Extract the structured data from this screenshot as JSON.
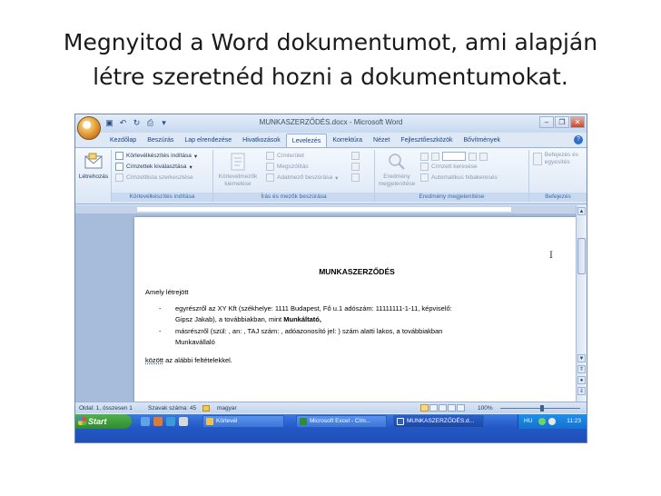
{
  "slide": {
    "title_line1": "Megnyitod a Word dokumentumot, ami alapján",
    "title_line2": "létre szeretnéd hozni a dokumentumokat."
  },
  "window": {
    "title": "MUNKASZERZŐDÉS.docx - Microsoft Word",
    "controls": [
      "–",
      "❐",
      "✕"
    ]
  },
  "ribbon": {
    "tabs": [
      "Kezdőlap",
      "Beszúrás",
      "Lap elrendezése",
      "Hivatkozások",
      "Levelezés",
      "Korrektúra",
      "Nézet",
      "Fejlesztőeszközök",
      "Bővítmények"
    ],
    "active_tab": "Levelezés",
    "groups": {
      "create": {
        "button": "Létrehozás"
      },
      "start_merge": {
        "label": "Körlevélkészítés indítása",
        "items": [
          "Körlevélkészítés indítása",
          "Címzettek kiválasztása",
          "Címzettlista szerkesztése"
        ]
      },
      "write_insert": {
        "label": "Írás és mezők beszúrása",
        "big": "Körlevélmezők kiemelése",
        "items": [
          "Címterület",
          "Megszólítás",
          "Adatmező beszúrása"
        ]
      },
      "preview": {
        "label": "Eredmény megjelenítése",
        "big": "Eredmény megjelenítése",
        "items": [
          "Címzett keresése",
          "Automatikus hibakeresés"
        ]
      },
      "finish": {
        "label": "Befejezés",
        "big": "Befejezés és egyesítés"
      }
    }
  },
  "document": {
    "title": "MUNKASZERZŐDÉS",
    "intro": "Amely létrejött",
    "bullet_1_line1": "egyrészről az XY Kft (székhelye: 1111 Budapest, Fő u.1 adószám: 11111111-1-11,  képviselő:",
    "bullet_1_line2_a": "Gipsz Jakab), a továbbiakban, mint ",
    "bullet_1_line2_b": "Munkáltató,",
    "bullet_2_line1": "másrészről (szül: , an: , TAJ szám:  , adóazonosító jel: ) szám alatti lakos, a továbbiakban",
    "bullet_2_line2": "Munkavállaló",
    "closing_a": "között",
    "closing_b": " az alábbi feltételekkel.",
    "bullet_mark": "-"
  },
  "statusbar": {
    "page": "Oldal: 1, összesen 1",
    "words": "Szavak száma: 45",
    "language": "magyar",
    "zoom": "100%"
  },
  "taskbar": {
    "start": "Start",
    "tasks": [
      "Körlevél",
      "Microsoft Excel - Cím...",
      "MUNKASZERZŐDÉS.d..."
    ],
    "lang": "HU",
    "clock": "11:23"
  },
  "colors": {
    "accent": "#15428b",
    "taskbar": "#2357c6",
    "start": "#3a9b38"
  }
}
